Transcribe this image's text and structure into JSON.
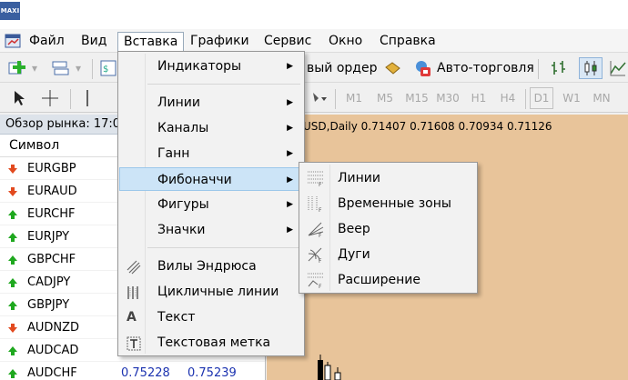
{
  "app": {
    "logo_text": "MAXI"
  },
  "menubar": {
    "items": [
      {
        "label": "Файл"
      },
      {
        "label": "Вид"
      },
      {
        "label": "Вставка"
      },
      {
        "label": "Графики"
      },
      {
        "label": "Сервис"
      },
      {
        "label": "Окно"
      },
      {
        "label": "Справка"
      }
    ]
  },
  "toolbar": {
    "new_order_label": "вый ордер",
    "auto_trading_label": "Авто-торговля",
    "periods": [
      "M1",
      "M5",
      "M15",
      "M30",
      "H1",
      "H4",
      "D1",
      "W1",
      "MN"
    ]
  },
  "market_watch": {
    "title": "Обзор рынка: 17:0",
    "column_symbol": "Символ",
    "rows": [
      {
        "symbol": "EURGBP",
        "dir": "down",
        "bid": "",
        "ask": ""
      },
      {
        "symbol": "EURAUD",
        "dir": "down",
        "bid": "",
        "ask": ""
      },
      {
        "symbol": "EURCHF",
        "dir": "up",
        "bid": "",
        "ask": ""
      },
      {
        "symbol": "EURJPY",
        "dir": "up",
        "bid": "",
        "ask": ""
      },
      {
        "symbol": "GBPCHF",
        "dir": "up",
        "bid": "",
        "ask": ""
      },
      {
        "symbol": "CADJPY",
        "dir": "up",
        "bid": "",
        "ask": ""
      },
      {
        "symbol": "GBPJPY",
        "dir": "up",
        "bid": "",
        "ask": ""
      },
      {
        "symbol": "AUDNZD",
        "dir": "down",
        "bid": "",
        "ask": ""
      },
      {
        "symbol": "AUDCAD",
        "dir": "up",
        "bid": "",
        "ask": ""
      },
      {
        "symbol": "AUDCHF",
        "dir": "up",
        "bid": "0.75228",
        "ask": "0.75239"
      }
    ]
  },
  "chart": {
    "title": "USD,Daily  0.71407 0.71608 0.70934 0.71126"
  },
  "insert_menu": {
    "items": [
      {
        "label": "Индикаторы",
        "submenu": true,
        "icon": ""
      },
      {
        "label": "Линии",
        "submenu": true,
        "icon": ""
      },
      {
        "label": "Каналы",
        "submenu": true,
        "icon": ""
      },
      {
        "label": "Ганн",
        "submenu": true,
        "icon": ""
      },
      {
        "label": "Фибоначчи",
        "submenu": true,
        "icon": "",
        "highlighted": true
      },
      {
        "label": "Фигуры",
        "submenu": true,
        "icon": ""
      },
      {
        "label": "Значки",
        "submenu": true,
        "icon": ""
      },
      {
        "label": "Вилы Эндрюса",
        "submenu": false,
        "icon": "andrews-pitchfork-icon"
      },
      {
        "label": "Цикличные линии",
        "submenu": false,
        "icon": "cycle-lines-icon"
      },
      {
        "label": "Текст",
        "submenu": false,
        "icon": "text-icon"
      },
      {
        "label": "Текстовая метка",
        "submenu": false,
        "icon": "text-label-icon"
      }
    ]
  },
  "fibonacci_submenu": {
    "items": [
      {
        "label": "Линии",
        "icon": "fibo-lines-icon"
      },
      {
        "label": "Временные зоны",
        "icon": "fibo-time-zones-icon"
      },
      {
        "label": "Веер",
        "icon": "fibo-fan-icon"
      },
      {
        "label": "Дуги",
        "icon": "fibo-arcs-icon"
      },
      {
        "label": "Расширение",
        "icon": "fibo-expansion-icon"
      }
    ]
  },
  "colors": {
    "chart_bg": "#e8c49a",
    "highlight": "#cce4f7",
    "price": "#1c33b0",
    "up": "#1fa81f",
    "down": "#e24a1f"
  }
}
